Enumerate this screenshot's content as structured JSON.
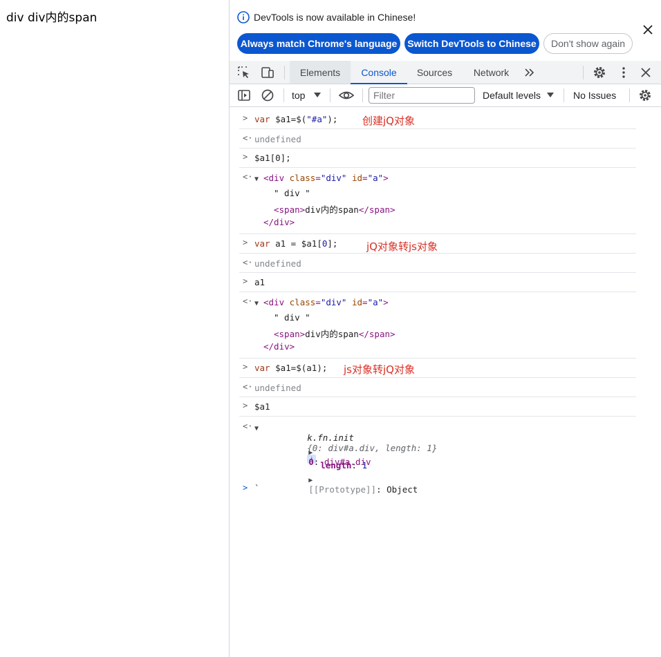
{
  "page": {
    "text": "div div内的span"
  },
  "infobar": {
    "message": "DevTools is now available in Chinese!",
    "btn_match": "Always match Chrome's language",
    "btn_switch": "Switch DevTools to Chinese",
    "btn_dont_show": "Don't show again"
  },
  "tabs": {
    "elements": "Elements",
    "console": "Console",
    "sources": "Sources",
    "network": "Network"
  },
  "console_toolbar": {
    "context": "top",
    "filter_placeholder": "Filter",
    "levels": "Default levels",
    "issues": "No Issues"
  },
  "console": {
    "lines": {
      "l1_code": "var $a1=$(\"#a\");",
      "l1_note": "创建jQ对象",
      "r1": "undefined",
      "l2_code": "$a1[0];",
      "el_open": "<div class=\"div\" id=\"a\">",
      "el_text": "\" div \"",
      "el_span": "<span>div内的span</span>",
      "el_close": "</div>",
      "l3_code": "var a1 = $a1[0];",
      "l3_note": "jQ对象转js对象",
      "r3": "undefined",
      "l4_code": "a1",
      "l5_code": "var $a1=$(a1);",
      "l5_note": "js对象转jQ对象",
      "r5": "undefined",
      "l6_code": "$a1",
      "obj_head": "k.fn.init",
      "obj_summary": "{0: div#a.div, length: 1}",
      "obj_p0_key": "0",
      "obj_p0_val": "div#a.div",
      "obj_len_key": "length",
      "obj_len_val": "1",
      "obj_proto_key": "[[Prototype]]",
      "obj_proto_val": "Object",
      "prompt_input": "`"
    }
  },
  "colors": {
    "accent": "#0b57d0",
    "annotation": "#d93025"
  }
}
